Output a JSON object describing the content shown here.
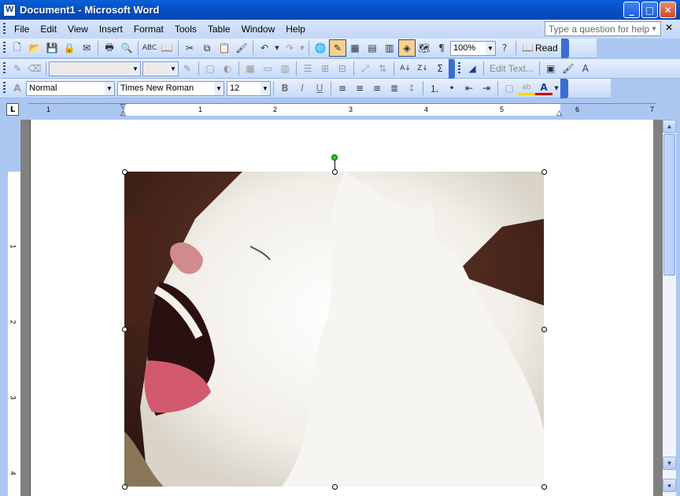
{
  "window": {
    "title": "Document1 - Microsoft Word"
  },
  "menubar": {
    "items": [
      "File",
      "Edit",
      "View",
      "Insert",
      "Format",
      "Tools",
      "Table",
      "Window",
      "Help"
    ],
    "help_placeholder": "Type a question for help"
  },
  "standard_toolbar": {
    "zoom": "100%",
    "read_label": "Read"
  },
  "drawing_toolbar": {
    "edit_text_label": "Edit Text..."
  },
  "formatting_toolbar": {
    "style": "Normal",
    "font": "Times New Roman",
    "size": "12"
  },
  "ruler": {
    "numbers": [
      "1",
      "1",
      "2",
      "3",
      "4",
      "5",
      "6",
      "7"
    ]
  },
  "vruler": {
    "numbers": [
      "1",
      "2",
      "3",
      "4"
    ]
  },
  "document": {
    "image_alt": "white lion yawning"
  },
  "colors": {
    "title_bar": "#0553c7",
    "toolbar": "#c6daf8",
    "highlight": "#f8d28b",
    "font_color": "#cc0000",
    "highlighter": "#ffd400"
  }
}
